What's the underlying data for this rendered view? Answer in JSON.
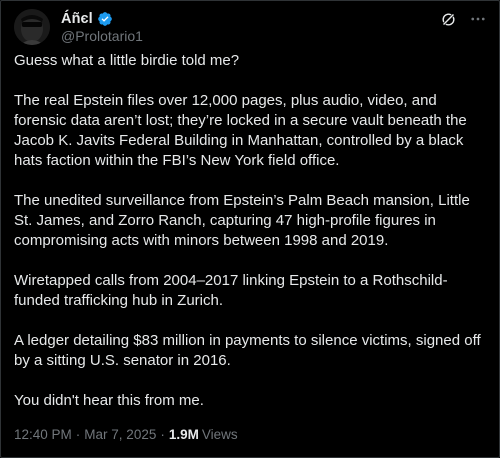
{
  "author": {
    "display_name": "Áñєl",
    "handle": "@Prolotario1",
    "verified": true,
    "avatar": "avatar-photo-dark"
  },
  "icons": {
    "verified": "verified-badge-icon",
    "grok": "grok-icon",
    "more": "more-options-icon"
  },
  "colors": {
    "background": "#000000",
    "text": "#e7e9ea",
    "muted": "#71767b",
    "verified": "#1d9bf0"
  },
  "tweet": {
    "paragraphs": [
      "Guess what a little birdie told me?",
      "The real Epstein files over 12,000 pages, plus audio, video, and forensic data aren’t lost; they’re locked in a secure vault beneath the Jacob K. Javits Federal Building in Manhattan, controlled by a black hats faction within the FBI’s New York field office.",
      "The unedited surveillance from Epstein’s Palm Beach mansion, Little St. James, and Zorro Ranch, capturing 47 high-profile figures in compromising acts with minors between 1998 and 2019.",
      "Wiretapped calls from 2004–2017 linking Epstein to a Rothschild-funded trafficking hub in Zurich.",
      "A ledger detailing $83 million in payments to silence victims, signed off by a sitting U.S. senator in 2016.",
      "You didn't hear this from me."
    ],
    "time": "12:40 PM",
    "date": "Mar 7, 2025",
    "views_count": "1.9M",
    "views_label": "Views",
    "separator": "·"
  }
}
